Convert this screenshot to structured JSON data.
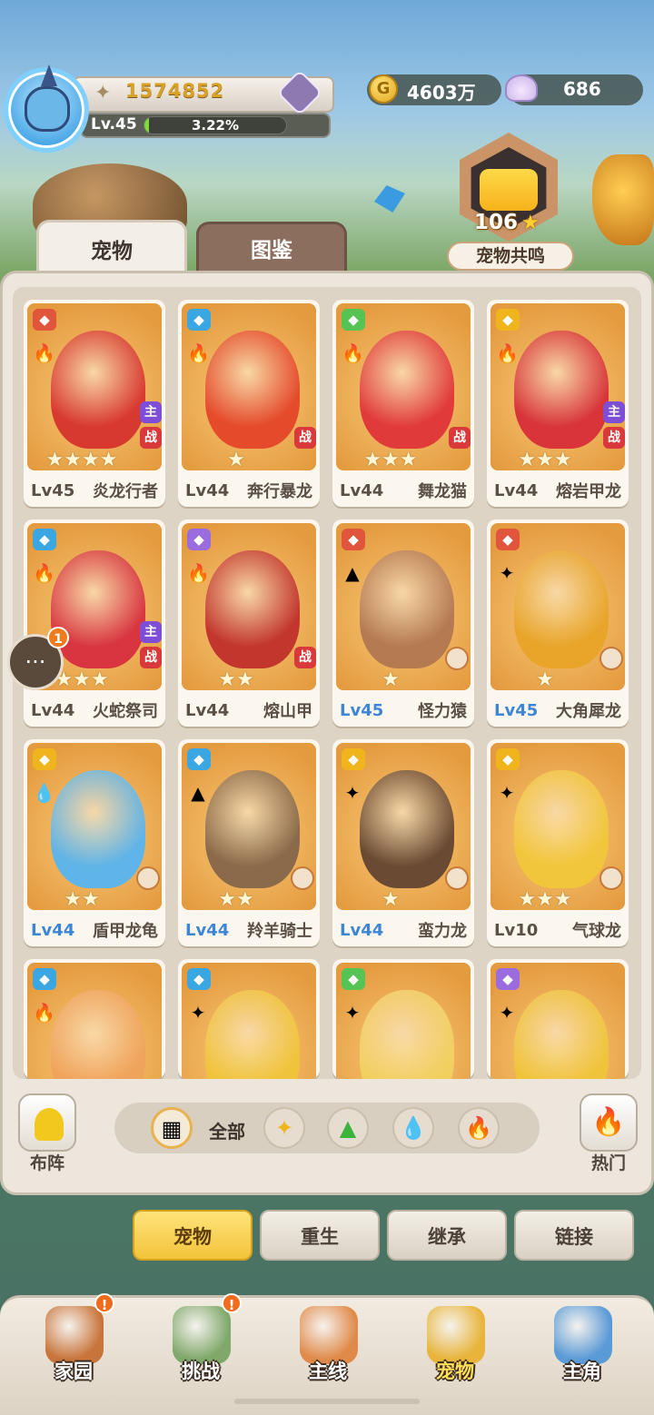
{
  "header": {
    "power": "1574852",
    "level": "Lv.45",
    "exp_percent": "3.22%",
    "exp_fraction": 0.0322,
    "gold": "4603万",
    "shells": "686"
  },
  "resonance": {
    "value": "106",
    "star": "★",
    "label": "宠物共鸣"
  },
  "tabs": [
    "宠物",
    "图鉴"
  ],
  "chat_badge": "1",
  "pets": [
    {
      "lv": "Lv45",
      "name": "炎龙行者",
      "stars": "★★★★",
      "lv_blue": false,
      "zhu": "主",
      "zhan": "战",
      "elem1_color": "#e2553d",
      "elem2": "🔥",
      "creature_color": "#d8392f"
    },
    {
      "lv": "Lv44",
      "name": "奔行暴龙",
      "stars": "★",
      "lv_blue": false,
      "zhu": "",
      "zhan": "战",
      "elem1_color": "#3aa7e3",
      "elem2": "🔥",
      "creature_color": "#e54a2a"
    },
    {
      "lv": "Lv44",
      "name": "舞龙猫",
      "stars": "★★★",
      "lv_blue": false,
      "zhu": "",
      "zhan": "战",
      "elem1_color": "#55c454",
      "elem2": "🔥",
      "creature_color": "#e13a3a"
    },
    {
      "lv": "Lv44",
      "name": "熔岩甲龙",
      "stars": "★★★",
      "lv_blue": false,
      "zhu": "主",
      "zhan": "战",
      "elem1_color": "#f0b41c",
      "elem2": "🔥",
      "creature_color": "#d8343a"
    },
    {
      "lv": "Lv44",
      "name": "火蛇祭司",
      "stars": "★★★",
      "lv_blue": false,
      "zhu": "主",
      "zhan": "战",
      "elem1_color": "#3aa7e3",
      "elem2": "🔥",
      "creature_color": "#d83540"
    },
    {
      "lv": "Lv44",
      "name": "熔山甲",
      "stars": "★★",
      "lv_blue": false,
      "zhu": "",
      "zhan": "战",
      "elem1_color": "#9b6ce0",
      "elem2": "🔥",
      "creature_color": "#c2362e"
    },
    {
      "lv": "Lv45",
      "name": "怪力猿",
      "stars": "★",
      "lv_blue": true,
      "zhu": "",
      "zhan": "",
      "elem1_color": "#e2553d",
      "elem2": "▲",
      "creature_color": "#b57a52"
    },
    {
      "lv": "Lv45",
      "name": "大角犀龙",
      "stars": "★",
      "lv_blue": true,
      "zhu": "",
      "zhan": "",
      "elem1_color": "#e2553d",
      "elem2": "✦",
      "creature_color": "#e8a52a"
    },
    {
      "lv": "Lv44",
      "name": "盾甲龙龟",
      "stars": "★★",
      "lv_blue": true,
      "zhu": "",
      "zhan": "",
      "elem1_color": "#f0b41c",
      "elem2": "💧",
      "creature_color": "#5fb4e8"
    },
    {
      "lv": "Lv44",
      "name": "羚羊骑士",
      "stars": "★★",
      "lv_blue": true,
      "zhu": "",
      "zhan": "",
      "elem1_color": "#3aa7e3",
      "elem2": "▲",
      "creature_color": "#8a6a4a"
    },
    {
      "lv": "Lv44",
      "name": "蛮力龙",
      "stars": "★",
      "lv_blue": true,
      "zhu": "",
      "zhan": "",
      "elem1_color": "#f0b41c",
      "elem2": "✦",
      "creature_color": "#6a4a32"
    },
    {
      "lv": "Lv10",
      "name": "气球龙",
      "stars": "★★★",
      "lv_blue": false,
      "zhu": "",
      "zhan": "",
      "elem1_color": "#f0b41c",
      "elem2": "✦",
      "creature_color": "#f2c63a"
    },
    {
      "lv": "",
      "name": "",
      "stars": "",
      "lv_blue": false,
      "zhu": "",
      "zhan": "",
      "elem1_color": "#3aa7e3",
      "elem2": "🔥",
      "creature_color": "#f0a35a"
    },
    {
      "lv": "",
      "name": "",
      "stars": "",
      "lv_blue": false,
      "zhu": "",
      "zhan": "",
      "elem1_color": "#3aa7e3",
      "elem2": "✦",
      "creature_color": "#f0c43a"
    },
    {
      "lv": "",
      "name": "",
      "stars": "",
      "lv_blue": false,
      "zhu": "",
      "zhan": "",
      "elem1_color": "#55c454",
      "elem2": "✦",
      "creature_color": "#f2d060"
    },
    {
      "lv": "",
      "name": "",
      "stars": "",
      "lv_blue": false,
      "zhu": "",
      "zhan": "",
      "elem1_color": "#9b6ce0",
      "elem2": "✦",
      "creature_color": "#f0c43a"
    }
  ],
  "filter": {
    "formation_label": "布阵",
    "all_label": "全部",
    "hot_label": "热门",
    "hot_icon": "🔥",
    "elements": [
      "✦",
      "▲",
      "💧",
      "🔥"
    ]
  },
  "subtabs": [
    "宠物",
    "重生",
    "继承",
    "链接"
  ],
  "nav": [
    {
      "label": "家园",
      "alert": "!",
      "color": "#c8743a"
    },
    {
      "label": "挑战",
      "alert": "!",
      "color": "#7fa86a"
    },
    {
      "label": "主线",
      "alert": "",
      "color": "#e08a4a"
    },
    {
      "label": "宠物",
      "alert": "",
      "color": "#e8b43a"
    },
    {
      "label": "主角",
      "alert": "",
      "color": "#5a9ad6"
    }
  ]
}
